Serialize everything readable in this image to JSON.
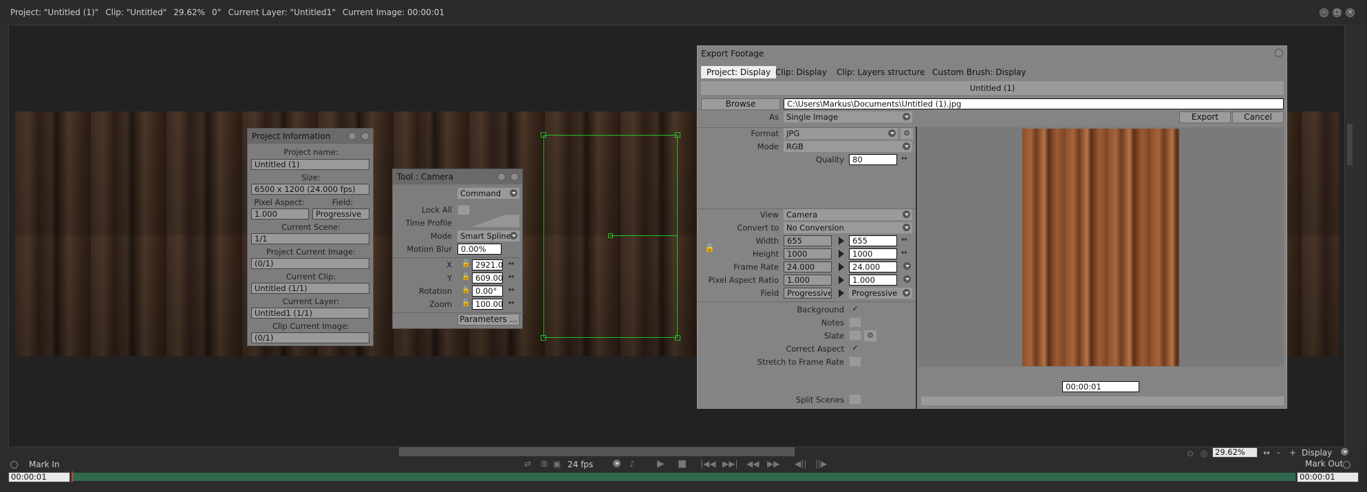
{
  "titlebar": {
    "project": "Project:  \"Untitled (1)\"",
    "clip": "Clip: \"Untitled\"",
    "zoom": "29.62%",
    "angle": "0°",
    "layer": "Current Layer: \"Untitled1\"",
    "image": "Current Image: 00:00:01"
  },
  "project_info": {
    "title": "Project Information",
    "project_name_label": "Project name:",
    "project_name": "Untitled (1)",
    "size_label": "Size:",
    "size": "6500 x 1200 (24.000 fps)",
    "pixel_aspect_label": "Pixel Aspect:",
    "pixel_aspect": "1.000",
    "field_label": "Field:",
    "field": "Progressive",
    "scene_label": "Current Scene:",
    "scene": "1/1",
    "proj_image_label": "Project Current Image:",
    "proj_image": "(0/1)",
    "clip_label": "Current Clip:",
    "clip": "Untitled (1/1)",
    "layer_label": "Current Layer:",
    "layer": "Untitled1 (1/1)",
    "clip_image_label": "Clip Current Image:",
    "clip_image": "(0/1)"
  },
  "camera": {
    "title": "Tool : Camera",
    "command": "Command",
    "lock_all": "Lock All",
    "time_profile": "Time Profile",
    "mode_label": "Mode",
    "mode": "Smart Spline",
    "motion_blur_label": "Motion Blur",
    "motion_blur": "0.00%",
    "x_label": "X",
    "x": "2921.0",
    "y_label": "Y",
    "y": "609.00",
    "rotation_label": "Rotation",
    "rotation": "0.00°",
    "zoom_label": "Zoom",
    "zoom": "100.00",
    "parameters": "Parameters ..."
  },
  "export": {
    "title": "Export Footage",
    "tabs": [
      "Project: Display",
      "Clip: Display",
      "Clip: Layers structure",
      "Custom Brush: Display"
    ],
    "header": "Untitled (1)",
    "browse": "Browse",
    "path": "C:\\Users\\Markus\\Documents\\Untitled (1).jpg",
    "as_label": "As",
    "as": "Single Image",
    "export_btn": "Export",
    "cancel_btn": "Cancel",
    "format_label": "Format",
    "format": "JPG",
    "mode_label": "Mode",
    "mode": "RGB",
    "quality_label": "Quality",
    "quality": "80",
    "view_label": "View",
    "view": "Camera",
    "convert_label": "Convert to",
    "convert": "No Conversion",
    "width_label": "Width",
    "width_src": "655",
    "width": "655",
    "height_label": "Height",
    "height_src": "1000",
    "height": "1000",
    "framerate_label": "Frame Rate",
    "framerate_src": "24.000",
    "framerate": "24.000",
    "par_label": "Pixel Aspect Ratio",
    "par_src": "1.000",
    "par": "1.000",
    "field_label": "Field",
    "field_src": "Progressive",
    "field": "Progressive",
    "background_label": "Background",
    "notes_label": "Notes",
    "slate_label": "Slate",
    "correct_aspect_label": "Correct Aspect",
    "stretch_label": "Stretch to Frame Rate",
    "split_label": "Split Scenes",
    "preview_time": "00:00:01",
    "check": "✓"
  },
  "timeline": {
    "mark_in": "Mark In",
    "mark_out": "Mark Out",
    "tc_left": "00:00:01",
    "tc_right": "00:00:01",
    "fps": "24 fps",
    "zoom": "29.62%",
    "display": "Display"
  }
}
